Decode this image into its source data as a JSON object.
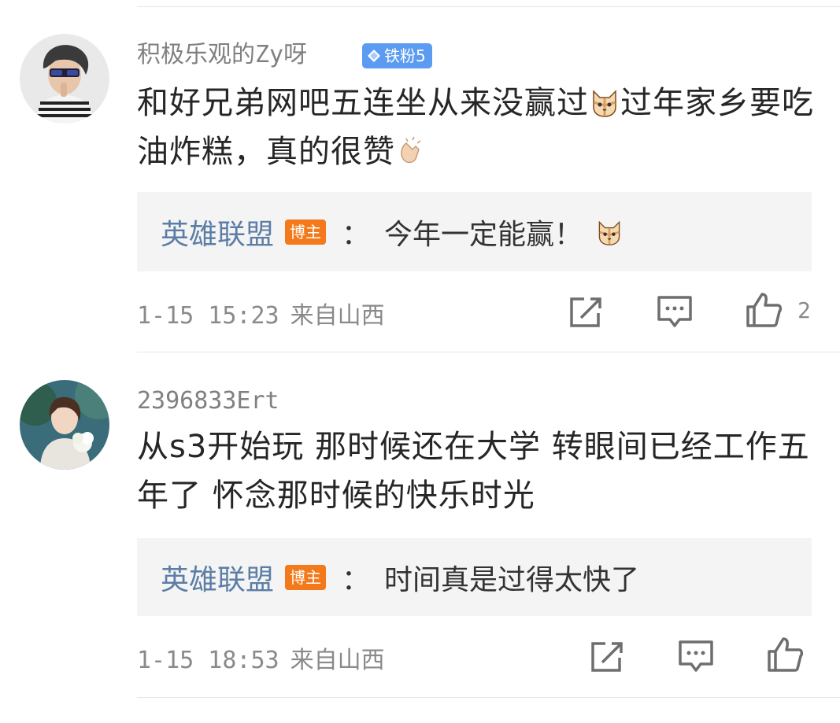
{
  "colors": {
    "link": "#5c7ea6",
    "fan_badge": "#5b9bf2",
    "blogger_badge": "#f3791a",
    "reply_bg": "#f4f4f4"
  },
  "comments": [
    {
      "username": "积极乐观的Zy呀",
      "fan_badge": "铁粉5",
      "fan_badge_icon": "diamond-icon",
      "content_part1": "和好兄弟网吧五连坐从来没赢过",
      "content_emoji1": "cat-emoji",
      "content_part2": "过年家乡要吃油炸糕，真的很赞",
      "content_emoji2": "clapping-hands-emoji",
      "reply": {
        "author": "英雄联盟",
        "badge": "博主",
        "colon": "：",
        "text": "今年一定能赢！",
        "emoji": "cat-emoji"
      },
      "time": "1-15 15:23",
      "location": "来自山西",
      "like_count": "2"
    },
    {
      "username": "2396833Ert",
      "content": "从s3开始玩 那时候还在大学 转眼间已经工作五年了 怀念那时候的快乐时光",
      "reply": {
        "author": "英雄联盟",
        "badge": "博主",
        "colon": "：",
        "text": "时间真是过得太快了"
      },
      "time": "1-15 18:53",
      "location": "来自山西",
      "like_count": ""
    }
  ]
}
